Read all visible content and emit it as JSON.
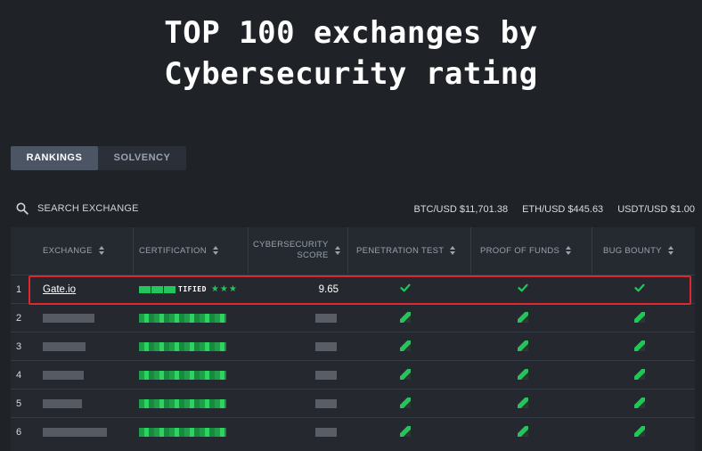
{
  "hero": {
    "line1": "TOP 100 exchanges by",
    "line2": "Cybersecurity rating"
  },
  "tabs": [
    {
      "label": "RANKINGS",
      "active": true
    },
    {
      "label": "SOLVENCY",
      "active": false
    }
  ],
  "search": {
    "label": "SEARCH EXCHANGE",
    "icon": "search-icon"
  },
  "rates": [
    {
      "text": "BTC/USD $11,701.38"
    },
    {
      "text": "ETH/USD $445.63"
    },
    {
      "text": "USDT/USD $1.00"
    }
  ],
  "columns": {
    "exchange": "EXCHANGE",
    "certification": "CERTIFICATION",
    "score_line1": "CYBERSECURITY",
    "score_line2": "SCORE",
    "pentest": "PENETRATION TEST",
    "funds": "PROOF OF FUNDS",
    "bounty": "BUG BOUNTY"
  },
  "rows": [
    {
      "rank": "1",
      "name": "Gate.io",
      "cert_text": "TIFIED",
      "stars": "★★★",
      "score": "9.65",
      "pentest": true,
      "funds": true,
      "bounty": true
    },
    {
      "rank": "2"
    },
    {
      "rank": "3"
    },
    {
      "rank": "4"
    },
    {
      "rank": "5"
    },
    {
      "rank": "6"
    }
  ],
  "colors": {
    "accent_green": "#22c55e",
    "highlight_red": "#e0262e",
    "background": "#1f2227"
  }
}
